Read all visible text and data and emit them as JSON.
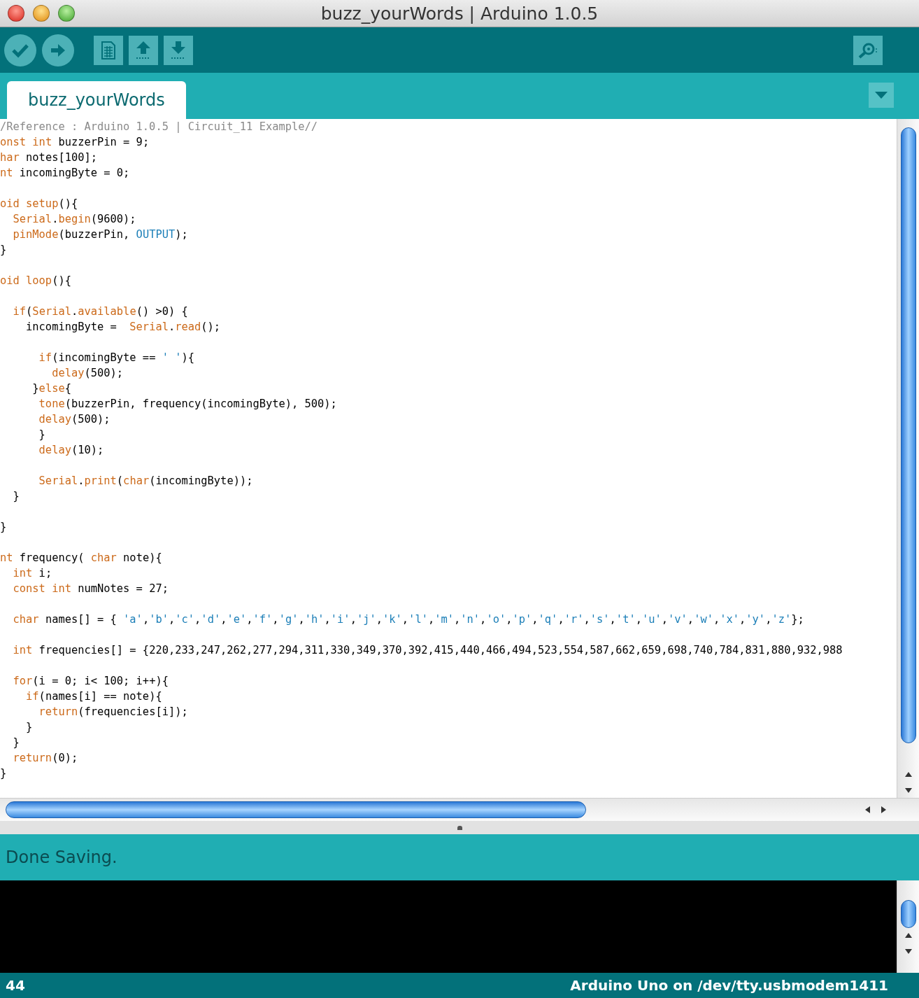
{
  "window": {
    "title": "buzz_yourWords | Arduino 1.0.5"
  },
  "toolbar": [
    {
      "kind": "verify"
    },
    {
      "kind": "upload"
    },
    {
      "kind": "new"
    },
    {
      "kind": "open"
    },
    {
      "kind": "save"
    },
    {
      "kind": "serial_monitor"
    }
  ],
  "tabs": [
    {
      "label": "buzz_yourWords",
      "selected": true
    }
  ],
  "editor": {
    "lines": [
      {
        "kind": "code",
        "tokens": [
          {
            "kind": "comment",
            "text": "/Reference : Arduino 1.0.5 | Circuit_11 Example//"
          }
        ]
      },
      {
        "kind": "code",
        "tokens": [
          {
            "kind": "keyword",
            "text": "onst "
          },
          {
            "kind": "keyword",
            "text": "int"
          },
          {
            "kind": "plain",
            "text": " buzzerPin = 9;"
          }
        ]
      },
      {
        "kind": "code",
        "tokens": [
          {
            "kind": "keyword",
            "text": "har"
          },
          {
            "kind": "plain",
            "text": " notes[100];"
          }
        ]
      },
      {
        "kind": "code",
        "tokens": [
          {
            "kind": "keyword",
            "text": "nt"
          },
          {
            "kind": "plain",
            "text": " incomingByte = 0;"
          }
        ]
      },
      {
        "kind": "blank"
      },
      {
        "kind": "code",
        "tokens": [
          {
            "kind": "keyword",
            "text": "oid setup"
          },
          {
            "kind": "plain",
            "text": "(){"
          }
        ]
      },
      {
        "kind": "code",
        "tokens": [
          {
            "kind": "keyword",
            "text": "  Serial"
          },
          {
            "kind": "plain",
            "text": "."
          },
          {
            "kind": "keyword",
            "text": "begin"
          },
          {
            "kind": "plain",
            "text": "(9600);"
          }
        ]
      },
      {
        "kind": "code",
        "tokens": [
          {
            "kind": "keyword",
            "text": "  pinMode"
          },
          {
            "kind": "plain",
            "text": "(buzzerPin, "
          },
          {
            "kind": "constant",
            "text": "OUTPUT"
          },
          {
            "kind": "plain",
            "text": ");"
          }
        ]
      },
      {
        "kind": "code",
        "tokens": [
          {
            "kind": "plain",
            "text": "}"
          }
        ]
      },
      {
        "kind": "blank"
      },
      {
        "kind": "code",
        "tokens": [
          {
            "kind": "keyword",
            "text": "oid loop"
          },
          {
            "kind": "plain",
            "text": "(){"
          }
        ]
      },
      {
        "kind": "blank"
      },
      {
        "kind": "code",
        "tokens": [
          {
            "kind": "keyword",
            "text": "  if"
          },
          {
            "kind": "plain",
            "text": "("
          },
          {
            "kind": "keyword",
            "text": "Serial"
          },
          {
            "kind": "plain",
            "text": "."
          },
          {
            "kind": "keyword",
            "text": "available"
          },
          {
            "kind": "plain",
            "text": "() >0) {"
          }
        ]
      },
      {
        "kind": "code",
        "tokens": [
          {
            "kind": "plain",
            "text": "    incomingByte =  "
          },
          {
            "kind": "keyword",
            "text": "Serial"
          },
          {
            "kind": "plain",
            "text": "."
          },
          {
            "kind": "keyword",
            "text": "read"
          },
          {
            "kind": "plain",
            "text": "();"
          }
        ]
      },
      {
        "kind": "blank"
      },
      {
        "kind": "code",
        "tokens": [
          {
            "kind": "keyword",
            "text": "      if"
          },
          {
            "kind": "plain",
            "text": "(incomingByte == "
          },
          {
            "kind": "constant",
            "text": "' '"
          },
          {
            "kind": "plain",
            "text": "){"
          }
        ]
      },
      {
        "kind": "code",
        "tokens": [
          {
            "kind": "keyword",
            "text": "        delay"
          },
          {
            "kind": "plain",
            "text": "(500);"
          }
        ]
      },
      {
        "kind": "code",
        "tokens": [
          {
            "kind": "plain",
            "text": "     }"
          },
          {
            "kind": "keyword",
            "text": "else"
          },
          {
            "kind": "plain",
            "text": "{"
          }
        ]
      },
      {
        "kind": "code",
        "tokens": [
          {
            "kind": "keyword",
            "text": "      tone"
          },
          {
            "kind": "plain",
            "text": "(buzzerPin, frequency(incomingByte), 500);"
          }
        ]
      },
      {
        "kind": "code",
        "tokens": [
          {
            "kind": "keyword",
            "text": "      delay"
          },
          {
            "kind": "plain",
            "text": "(500);"
          }
        ]
      },
      {
        "kind": "code",
        "tokens": [
          {
            "kind": "plain",
            "text": "      }"
          }
        ]
      },
      {
        "kind": "code",
        "tokens": [
          {
            "kind": "keyword",
            "text": "      delay"
          },
          {
            "kind": "plain",
            "text": "(10);"
          }
        ]
      },
      {
        "kind": "blank"
      },
      {
        "kind": "code",
        "tokens": [
          {
            "kind": "keyword",
            "text": "      Serial"
          },
          {
            "kind": "plain",
            "text": "."
          },
          {
            "kind": "keyword",
            "text": "print"
          },
          {
            "kind": "plain",
            "text": "("
          },
          {
            "kind": "keyword",
            "text": "char"
          },
          {
            "kind": "plain",
            "text": "(incomingByte));"
          }
        ]
      },
      {
        "kind": "code",
        "tokens": [
          {
            "kind": "plain",
            "text": "  }"
          }
        ]
      },
      {
        "kind": "blank"
      },
      {
        "kind": "code",
        "tokens": [
          {
            "kind": "plain",
            "text": "}"
          }
        ]
      },
      {
        "kind": "blank"
      },
      {
        "kind": "code",
        "tokens": [
          {
            "kind": "keyword",
            "text": "nt"
          },
          {
            "kind": "plain",
            "text": " frequency( "
          },
          {
            "kind": "keyword",
            "text": "char"
          },
          {
            "kind": "plain",
            "text": " note){"
          }
        ]
      },
      {
        "kind": "code",
        "tokens": [
          {
            "kind": "keyword",
            "text": "  int"
          },
          {
            "kind": "plain",
            "text": " i;"
          }
        ]
      },
      {
        "kind": "code",
        "tokens": [
          {
            "kind": "keyword",
            "text": "  const int"
          },
          {
            "kind": "plain",
            "text": " numNotes = 27;"
          }
        ]
      },
      {
        "kind": "blank"
      },
      {
        "kind": "code",
        "tokens": [
          {
            "kind": "keyword",
            "text": "  char"
          },
          {
            "kind": "plain",
            "text": " names[] = { "
          },
          {
            "kind": "constant",
            "text": "'a'"
          },
          {
            "kind": "plain",
            "text": ","
          },
          {
            "kind": "constant",
            "text": "'b'"
          },
          {
            "kind": "plain",
            "text": ","
          },
          {
            "kind": "constant",
            "text": "'c'"
          },
          {
            "kind": "plain",
            "text": ","
          },
          {
            "kind": "constant",
            "text": "'d'"
          },
          {
            "kind": "plain",
            "text": ","
          },
          {
            "kind": "constant",
            "text": "'e'"
          },
          {
            "kind": "plain",
            "text": ","
          },
          {
            "kind": "constant",
            "text": "'f'"
          },
          {
            "kind": "plain",
            "text": ","
          },
          {
            "kind": "constant",
            "text": "'g'"
          },
          {
            "kind": "plain",
            "text": ","
          },
          {
            "kind": "constant",
            "text": "'h'"
          },
          {
            "kind": "plain",
            "text": ","
          },
          {
            "kind": "constant",
            "text": "'i'"
          },
          {
            "kind": "plain",
            "text": ","
          },
          {
            "kind": "constant",
            "text": "'j'"
          },
          {
            "kind": "plain",
            "text": ","
          },
          {
            "kind": "constant",
            "text": "'k'"
          },
          {
            "kind": "plain",
            "text": ","
          },
          {
            "kind": "constant",
            "text": "'l'"
          },
          {
            "kind": "plain",
            "text": ","
          },
          {
            "kind": "constant",
            "text": "'m'"
          },
          {
            "kind": "plain",
            "text": ","
          },
          {
            "kind": "constant",
            "text": "'n'"
          },
          {
            "kind": "plain",
            "text": ","
          },
          {
            "kind": "constant",
            "text": "'o'"
          },
          {
            "kind": "plain",
            "text": ","
          },
          {
            "kind": "constant",
            "text": "'p'"
          },
          {
            "kind": "plain",
            "text": ","
          },
          {
            "kind": "constant",
            "text": "'q'"
          },
          {
            "kind": "plain",
            "text": ","
          },
          {
            "kind": "constant",
            "text": "'r'"
          },
          {
            "kind": "plain",
            "text": ","
          },
          {
            "kind": "constant",
            "text": "'s'"
          },
          {
            "kind": "plain",
            "text": ","
          },
          {
            "kind": "constant",
            "text": "'t'"
          },
          {
            "kind": "plain",
            "text": ","
          },
          {
            "kind": "constant",
            "text": "'u'"
          },
          {
            "kind": "plain",
            "text": ","
          },
          {
            "kind": "constant",
            "text": "'v'"
          },
          {
            "kind": "plain",
            "text": ","
          },
          {
            "kind": "constant",
            "text": "'w'"
          },
          {
            "kind": "plain",
            "text": ","
          },
          {
            "kind": "constant",
            "text": "'x'"
          },
          {
            "kind": "plain",
            "text": ","
          },
          {
            "kind": "constant",
            "text": "'y'"
          },
          {
            "kind": "plain",
            "text": ","
          },
          {
            "kind": "constant",
            "text": "'z'"
          },
          {
            "kind": "plain",
            "text": "};"
          }
        ]
      },
      {
        "kind": "blank"
      },
      {
        "kind": "code",
        "tokens": [
          {
            "kind": "keyword",
            "text": "  int"
          },
          {
            "kind": "plain",
            "text": " frequencies[] = {220,233,247,262,277,294,311,330,349,370,392,415,440,466,494,523,554,587,662,659,698,740,784,831,880,932,988"
          }
        ]
      },
      {
        "kind": "blank"
      },
      {
        "kind": "code",
        "tokens": [
          {
            "kind": "keyword",
            "text": "  for"
          },
          {
            "kind": "plain",
            "text": "(i = 0; i< 100; i++){"
          }
        ]
      },
      {
        "kind": "code",
        "tokens": [
          {
            "kind": "keyword",
            "text": "    if"
          },
          {
            "kind": "plain",
            "text": "(names[i] == note){"
          }
        ]
      },
      {
        "kind": "code",
        "tokens": [
          {
            "kind": "keyword",
            "text": "      return"
          },
          {
            "kind": "plain",
            "text": "(frequencies[i]);"
          }
        ]
      },
      {
        "kind": "code",
        "tokens": [
          {
            "kind": "plain",
            "text": "    }"
          }
        ]
      },
      {
        "kind": "code",
        "tokens": [
          {
            "kind": "plain",
            "text": "  }"
          }
        ]
      },
      {
        "kind": "code",
        "tokens": [
          {
            "kind": "keyword",
            "text": "  return"
          },
          {
            "kind": "plain",
            "text": "(0);"
          }
        ]
      },
      {
        "kind": "code",
        "tokens": [
          {
            "kind": "plain",
            "text": "}"
          }
        ]
      }
    ]
  },
  "message": "Done Saving.",
  "status_bar": {
    "line": "44",
    "board": "Arduino Uno on /dev/tty.usbmodem1411"
  }
}
